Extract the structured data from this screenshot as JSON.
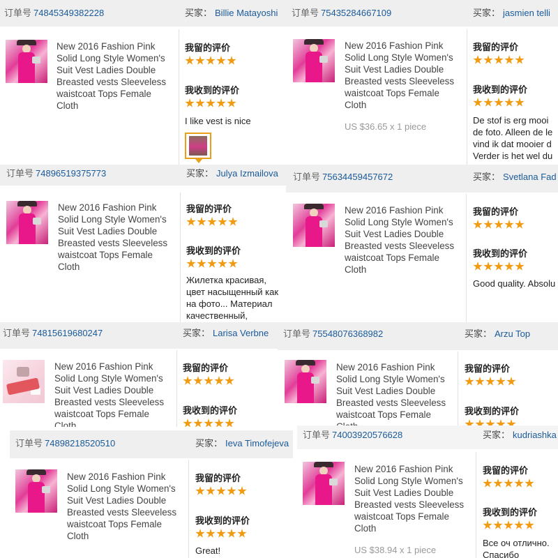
{
  "order_label": "订单号",
  "buyer_label": "买家：",
  "rating_given_label": "我留的评价",
  "rating_received_label": "我收到的评价",
  "colors": {
    "link": "#1a5a9a",
    "star": "#f09b12",
    "header_bg": "#efefef"
  },
  "orders": [
    {
      "order_no": "74845349382228",
      "buyer": "Billie Matayoshi",
      "product_title": "New 2016 Fashion Pink Solid Long Style Women's Suit Vest Ladies Double Breasted vests Sleeveless waistcoat Tops Female Cloth",
      "price": "",
      "given_stars": 5,
      "received_stars": 5,
      "feedback": "I like vest is nice",
      "has_photo": true
    },
    {
      "order_no": "75435284667109",
      "buyer": "jasmien telli",
      "product_title": "New 2016 Fashion Pink Solid Long Style Women's Suit Vest Ladies Double Breasted vests Sleeveless waistcoat Tops Female Cloth",
      "price": "US $36.65 x 1 piece",
      "given_stars": 5,
      "received_stars": 5,
      "feedback": "De stof is erg mooi de foto. Alleen de le vind ik dat mooier d Verder is het wel du",
      "has_photo": false
    },
    {
      "order_no": "74896519375773",
      "buyer": "Julya Izmailova",
      "product_title": "New 2016 Fashion Pink Solid Long Style Women's Suit Vest Ladies Double Breasted vests Sleeveless waistcoat Tops Female Cloth",
      "price": "",
      "given_stars": 5,
      "received_stars": 5,
      "feedback": "Жилетка красивая, цвет насыщенный как на фото... Материал качественный, приятный на ощупь.... Но пуговицы можно было бы пришить получше...",
      "has_photo": false
    },
    {
      "order_no": "75634459457672",
      "buyer": "Svetlana Fad",
      "product_title": "New 2016 Fashion Pink Solid Long Style Women's Suit Vest Ladies Double Breasted vests Sleeveless waistcoat Tops Female Cloth",
      "price": "",
      "given_stars": 5,
      "received_stars": 5,
      "feedback": "Good quality. Absolu",
      "has_photo": false
    },
    {
      "order_no": "74815619680247",
      "buyer": "Larisa Verbne",
      "product_title": "New 2016 Fashion Pink Solid Long Style Women's Suit Vest Ladies Double Breasted vests Sleeveless waistcoat Tops Female Cloth",
      "price": "",
      "given_stars": 5,
      "received_stars": 5,
      "feedback": "",
      "has_photo": false
    },
    {
      "order_no": "75548076368982",
      "buyer": "Arzu Top",
      "product_title": "New 2016 Fashion Pink Solid Long Style Women's Suit Vest Ladies Double Breasted vests Sleeveless waistcoat Tops Female Cloth",
      "price": "",
      "given_stars": 5,
      "received_stars": 5,
      "feedback": "",
      "has_photo": false
    },
    {
      "order_no": "74898218520510",
      "buyer": "Ieva Timofejeva",
      "product_title": "New 2016 Fashion Pink Solid Long Style Women's Suit Vest Ladies Double Breasted vests Sleeveless waistcoat Tops Female Cloth",
      "price": "",
      "given_stars": 5,
      "received_stars": 5,
      "feedback": "Great!",
      "has_photo": false
    },
    {
      "order_no": "74003920576628",
      "buyer": "kudriashka",
      "product_title": "New 2016 Fashion Pink Solid Long Style Women's Suit Vest Ladies Double Breasted vests Sleeveless waistcoat Tops Female Cloth",
      "price": "US $38.94 x 1 piece",
      "given_stars": 5,
      "received_stars": 5,
      "feedback": "Все оч отлично. Спасибо",
      "has_photo": false
    }
  ]
}
